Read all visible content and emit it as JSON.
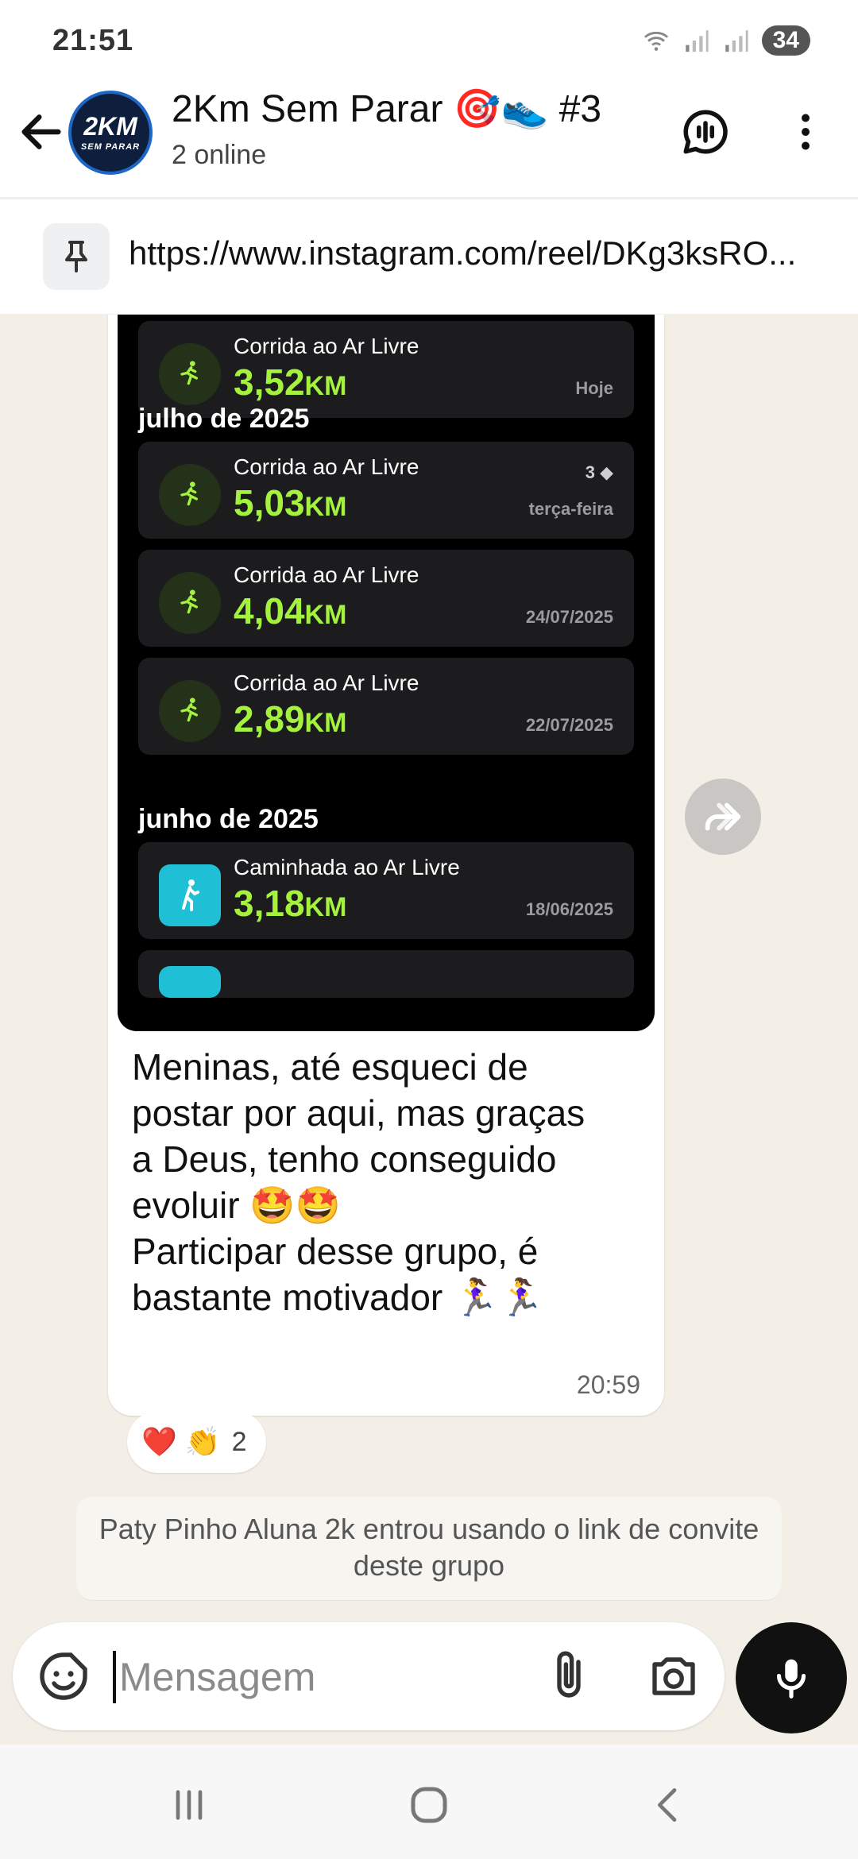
{
  "status_bar": {
    "time": "21:51",
    "battery": "34"
  },
  "header": {
    "title": "2Km Sem Parar 🎯👟 #3",
    "subtitle": "2 online",
    "avatar_text_top": "2KM",
    "avatar_text_bottom": "SEM PARAR"
  },
  "pinned": {
    "text": "https://www.instagram.com/reel/DKg3ksRO..."
  },
  "message": {
    "screenshot": {
      "top_card": {
        "label": "Corrida ao Ar Livre",
        "distance": "3,52",
        "unit": "KM",
        "when": "Hoje"
      },
      "sections": [
        {
          "title": "julho de 2025",
          "cards": [
            {
              "label": "Corrida ao Ar Livre",
              "distance": "5,03",
              "unit": "KM",
              "when": "terça-feira",
              "count": "3"
            },
            {
              "label": "Corrida ao Ar Livre",
              "distance": "4,04",
              "unit": "KM",
              "when": "24/07/2025"
            },
            {
              "label": "Corrida ao Ar Livre",
              "distance": "2,89",
              "unit": "KM",
              "when": "22/07/2025"
            }
          ]
        },
        {
          "title": "junho de 2025",
          "cards": [
            {
              "label": "Caminhada ao Ar Livre",
              "distance": "3,18",
              "unit": "KM",
              "when": "18/06/2025"
            }
          ]
        }
      ]
    },
    "text_lines": [
      "Meninas, até esqueci de",
      "postar por aqui, mas graças",
      "a Deus, tenho conseguido",
      "evoluir 🤩🤩",
      "Participar desse grupo, é",
      "bastante motivador 🏃‍♀️🏃‍♀️"
    ],
    "time": "20:59",
    "reactions": {
      "emojis": "❤️ 👏",
      "count": "2"
    }
  },
  "system_message": "Paty Pinho Aluna 2k entrou usando o link de convite deste grupo",
  "composer": {
    "placeholder": "Mensagem"
  },
  "colors": {
    "accent_green": "#a4f23d",
    "bubble": "#ffffff",
    "chat_bg": "#f3efe6"
  }
}
